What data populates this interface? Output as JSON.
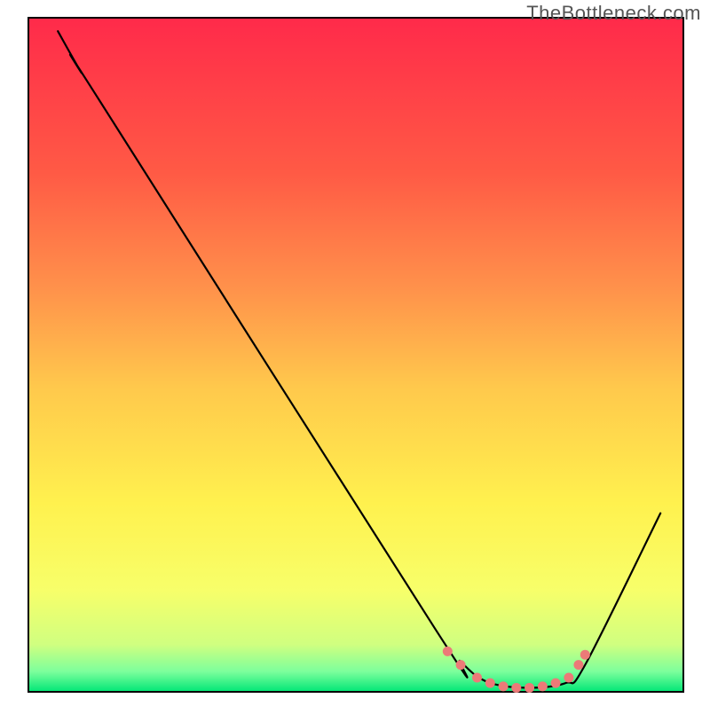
{
  "watermark": "TheBottleneck.com",
  "chart_data": {
    "type": "line",
    "title": "",
    "xlabel": "",
    "ylabel": "",
    "xlim": [
      0,
      100
    ],
    "ylim": [
      0,
      100
    ],
    "grid": false,
    "legend": false,
    "background_gradient": {
      "stops": [
        {
          "offset": 0.0,
          "color": "#ff2a4a"
        },
        {
          "offset": 0.23,
          "color": "#ff5a45"
        },
        {
          "offset": 0.4,
          "color": "#ff914b"
        },
        {
          "offset": 0.55,
          "color": "#ffc94c"
        },
        {
          "offset": 0.72,
          "color": "#fff14e"
        },
        {
          "offset": 0.85,
          "color": "#f7ff6a"
        },
        {
          "offset": 0.93,
          "color": "#d0ff80"
        },
        {
          "offset": 0.97,
          "color": "#7cff9c"
        },
        {
          "offset": 1.0,
          "color": "#00e676"
        }
      ]
    },
    "curve": {
      "description": "Bottleneck curve: high mismatch at low x, descending to near-zero around x≈78, then rising again",
      "points": [
        {
          "x": 4.5,
          "y": 98.0
        },
        {
          "x": 8.0,
          "y": 92.0
        },
        {
          "x": 11.0,
          "y": 87.5
        },
        {
          "x": 62.0,
          "y": 9.5
        },
        {
          "x": 66.0,
          "y": 4.5
        },
        {
          "x": 70.0,
          "y": 1.5
        },
        {
          "x": 76.0,
          "y": 0.6
        },
        {
          "x": 82.0,
          "y": 1.3
        },
        {
          "x": 85.0,
          "y": 4.0
        },
        {
          "x": 96.5,
          "y": 26.5
        }
      ]
    },
    "optimal_markers": {
      "description": "Dotted salmon segment marking the low-plateau region",
      "color": "#ec7a78",
      "points": [
        {
          "x": 64.0,
          "y": 6.0
        },
        {
          "x": 66.0,
          "y": 4.0
        },
        {
          "x": 68.5,
          "y": 2.1
        },
        {
          "x": 70.5,
          "y": 1.3
        },
        {
          "x": 72.5,
          "y": 0.8
        },
        {
          "x": 74.5,
          "y": 0.6
        },
        {
          "x": 76.5,
          "y": 0.6
        },
        {
          "x": 78.5,
          "y": 0.8
        },
        {
          "x": 80.5,
          "y": 1.3
        },
        {
          "x": 82.5,
          "y": 2.1
        },
        {
          "x": 84.0,
          "y": 4.0
        },
        {
          "x": 85.0,
          "y": 5.5
        }
      ]
    }
  }
}
